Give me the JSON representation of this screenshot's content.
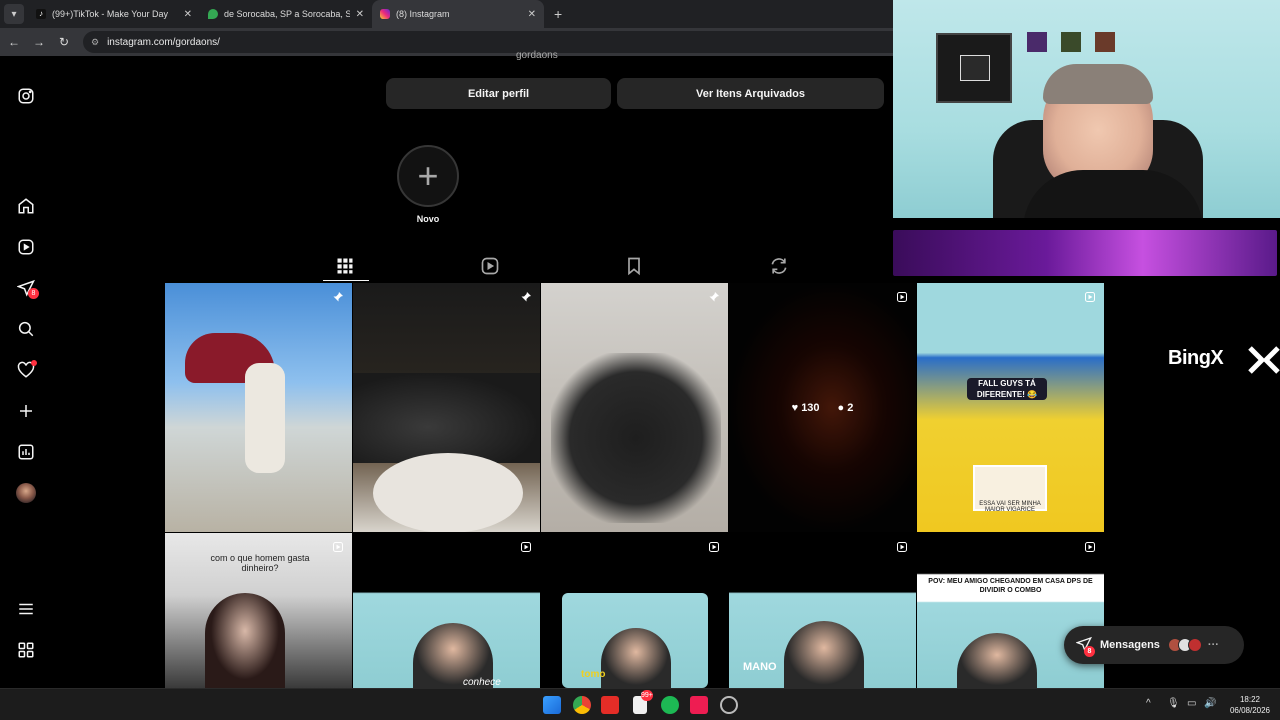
{
  "browser": {
    "tabs": [
      {
        "title": "(99+)TikTok - Make Your Day",
        "icon": "tiktok-icon",
        "active": false
      },
      {
        "title": "de Sorocaba, SP a Sorocaba, SP",
        "icon": "maps-icon",
        "active": false
      },
      {
        "title": "(8) Instagram",
        "icon": "instagram-icon",
        "active": true
      }
    ],
    "url": "instagram.com/gordaons/"
  },
  "nav": {
    "messages_badge": "8"
  },
  "profile": {
    "username_partial": "gordaons",
    "edit_button": "Editar perfil",
    "archive_button": "Ver Itens Arquivados",
    "new_highlight_label": "Novo"
  },
  "posts": {
    "row1": [
      {
        "type": "pinned"
      },
      {
        "type": "pinned"
      },
      {
        "type": "pinned"
      },
      {
        "type": "reel",
        "likes": "130",
        "comments": "2"
      },
      {
        "type": "reel",
        "top_text": "FALL GUYS TÁ DIFERENTE! 😂",
        "bottom_text": "ESSA VAI SER MINHA MAIOR VIGARICE"
      }
    ],
    "row2": [
      {
        "type": "reel",
        "caption": "com o que homem gasta dinheiro?"
      },
      {
        "type": "reel",
        "overlay": "conhece"
      },
      {
        "type": "reel",
        "overlay": "tomo"
      },
      {
        "type": "reel",
        "overlay": "MANO"
      },
      {
        "type": "reel",
        "caption": "POV: MEU AMIGO CHEGANDO EM CASA DPS DE DIVIDIR O COMBO"
      }
    ]
  },
  "overlay": {
    "sponsor": "BingX"
  },
  "messages": {
    "label": "Mensagens",
    "badge": "8"
  },
  "taskbar": {
    "time": "18:22",
    "date": "06/08/2026",
    "notes_badge": "99+"
  },
  "colors": {
    "accent_badge": "#ff3040",
    "button_bg": "#262626",
    "background": "#000000"
  }
}
